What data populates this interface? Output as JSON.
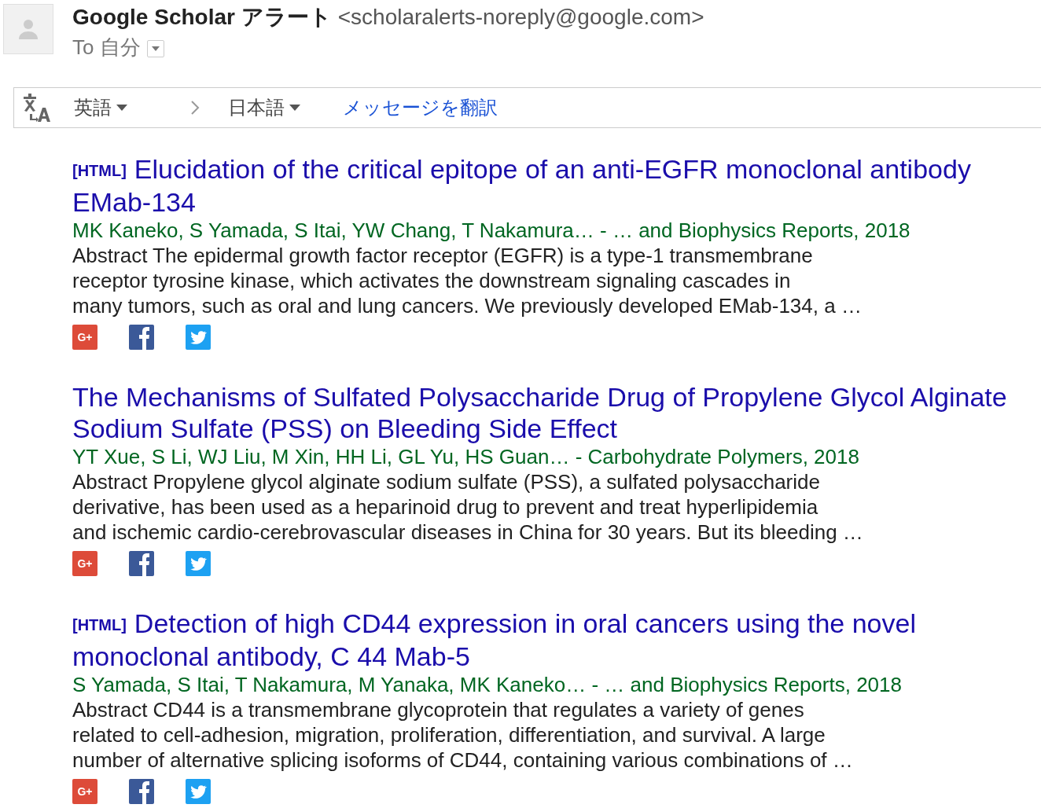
{
  "header": {
    "sender_name": "Google Scholar アラート",
    "sender_email": "<scholaralerts-noreply@google.com>",
    "recipient": "To 自分"
  },
  "translate_bar": {
    "source_language": "英語",
    "target_language": "日本語",
    "translate_link": "メッセージを翻訳"
  },
  "results": [
    {
      "tag": "[HTML]",
      "title": "Elucidation of the critical epitope of an anti-EGFR monoclonal antibody EMab-134",
      "authors": "MK Kaneko, S Yamada, S Itai, YW Chang, T Nakamura… - … and Biophysics Reports, 2018",
      "abstract_lines": [
        "Abstract The epidermal growth factor receptor (EGFR) is a type-1 transmembrane",
        "receptor tyrosine kinase, which activates the downstream signaling cascades in",
        "many tumors, such as oral and lung cancers. We previously developed EMab-134, a …"
      ],
      "share_label": "G+"
    },
    {
      "title": "The Mechanisms of Sulfated Polysaccharide Drug of Propylene Glycol Alginate Sodium Sulfate (PSS) on Bleeding Side Effect",
      "authors": "YT Xue, S Li, WJ Liu, M Xin, HH Li, GL Yu, HS Guan… - Carbohydrate Polymers, 2018",
      "abstract_lines": [
        "Abstract Propylene glycol alginate sodium sulfate (PSS), a sulfated polysaccharide",
        "derivative, has been used as a heparinoid drug to prevent and treat hyperlipidemia",
        "and ischemic cardio-cerebrovascular diseases in China for 30 years. But its bleeding …"
      ],
      "share_label": "G+"
    },
    {
      "tag": "[HTML]",
      "title": "Detection of high CD44 expression in oral cancers using the novel monoclonal antibody, C 44 Mab-5",
      "authors": "S Yamada, S Itai, T Nakamura, M Yanaka, MK Kaneko… - … and Biophysics Reports, 2018",
      "abstract_lines": [
        "Abstract CD44 is a transmembrane glycoprotein that regulates a variety of genes",
        "related to cell-adhesion, migration, proliferation, differentiation, and survival. A large",
        "number of alternative splicing isoforms of CD44, containing various combinations of …"
      ],
      "share_label": "G+"
    }
  ]
}
